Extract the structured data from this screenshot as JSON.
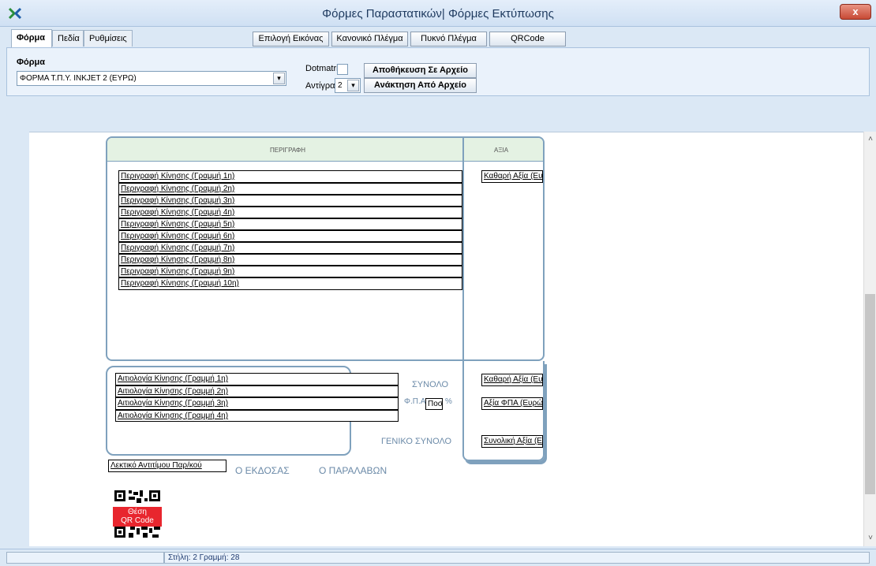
{
  "window": {
    "title": "Φόρμες Παραστατικών| Φόρμες Εκτύπωσης",
    "close_label": "x"
  },
  "tabs": [
    {
      "label": "Φόρμα",
      "active": true
    },
    {
      "label": "Πεδία",
      "active": false
    },
    {
      "label": "Ρυθμίσεις",
      "active": false
    }
  ],
  "toolbar": {
    "image_select": "Επιλογή Εικόνας",
    "normal_grid": "Κανονικό Πλέγμα",
    "dense_grid": "Πυκνό Πλέγμα",
    "qrcode": "QRCode"
  },
  "form_panel": {
    "form_label": "Φόρμα",
    "form_value": "ΦΟΡΜΑ Τ.Π.Υ. INKJET 2 (ΕΥΡΩ)",
    "dotmatrix_label": "Dotmatrix",
    "dotmatrix_checked": false,
    "copies_label": "Αντίγραφα",
    "copies_value": "2",
    "save_button": "Αποθήκευση Σε Αρχείο",
    "load_button": "Ανάκτηση Από Αρχείο"
  },
  "invoice": {
    "description_header": "ΠΕΡΙΓΡΑΦΗ",
    "value_header": "ΑΞΙΑ",
    "line_items": [
      "Περιγραφή Κίνησης (Γραμμή 1η)",
      "Περιγραφή Κίνησης (Γραμμή 2η)",
      "Περιγραφή Κίνησης (Γραμμή 3η)",
      "Περιγραφή Κίνησης (Γραμμή 4η)",
      "Περιγραφή Κίνησης (Γραμμή 5η)",
      "Περιγραφή Κίνησης (Γραμμή 6η)",
      "Περιγραφή Κίνησης (Γραμμή 7η)",
      "Περιγραφή Κίνησης (Γραμμή 8η)",
      "Περιγραφή Κίνησης (Γραμμή 9η)",
      "Περιγραφή Κίνησης (Γραμμή 10η)"
    ],
    "net_value_field": "Καθαρή Αξία (Ευρώ)",
    "reason_lines": [
      "Αιτιολογία Κίνησης (Γραμμή 1η)",
      "Αιτιολογία Κίνησης (Γραμμή 2η)",
      "Αιτιολογία Κίνησης (Γραμμή 3η)",
      "Αιτιολογία Κίνησης (Γραμμή 4η)"
    ],
    "subtotal_label": "ΣΥΝΟΛΟ",
    "vat_label": "Φ.Π.Α",
    "vat_field": "Ποσ",
    "percent_sign": "%",
    "grand_total_label": "ΓΕΝΙΚΟ ΣΥΝΟΛΟ",
    "total_net_field": "Καθαρή Αξία (Ευρώ)",
    "vat_value_field": "Αξία ΦΠΑ (Ευρώ)",
    "total_value_field": "Συνολική Αξία (Ευρώ)",
    "amount_words_field": "Λεκτικό Αντιτίμου Παρ/κού",
    "issuer_label": "Ο ΕΚΔΟΣΑΣ",
    "receiver_label": "Ο ΠΑΡΑΛΑΒΩΝ",
    "qr_label_line1": "Θέση",
    "qr_label_line2": "QR Code"
  },
  "statusbar": {
    "position_text": "Στήλη: 2  Γραμμή: 28"
  },
  "colors": {
    "titlebar": "#cfe0f3",
    "close_button": "#c74a35",
    "box_border": "#7fa1bd",
    "header_fill": "#e4f2e3",
    "qr_red": "#e8262e"
  }
}
